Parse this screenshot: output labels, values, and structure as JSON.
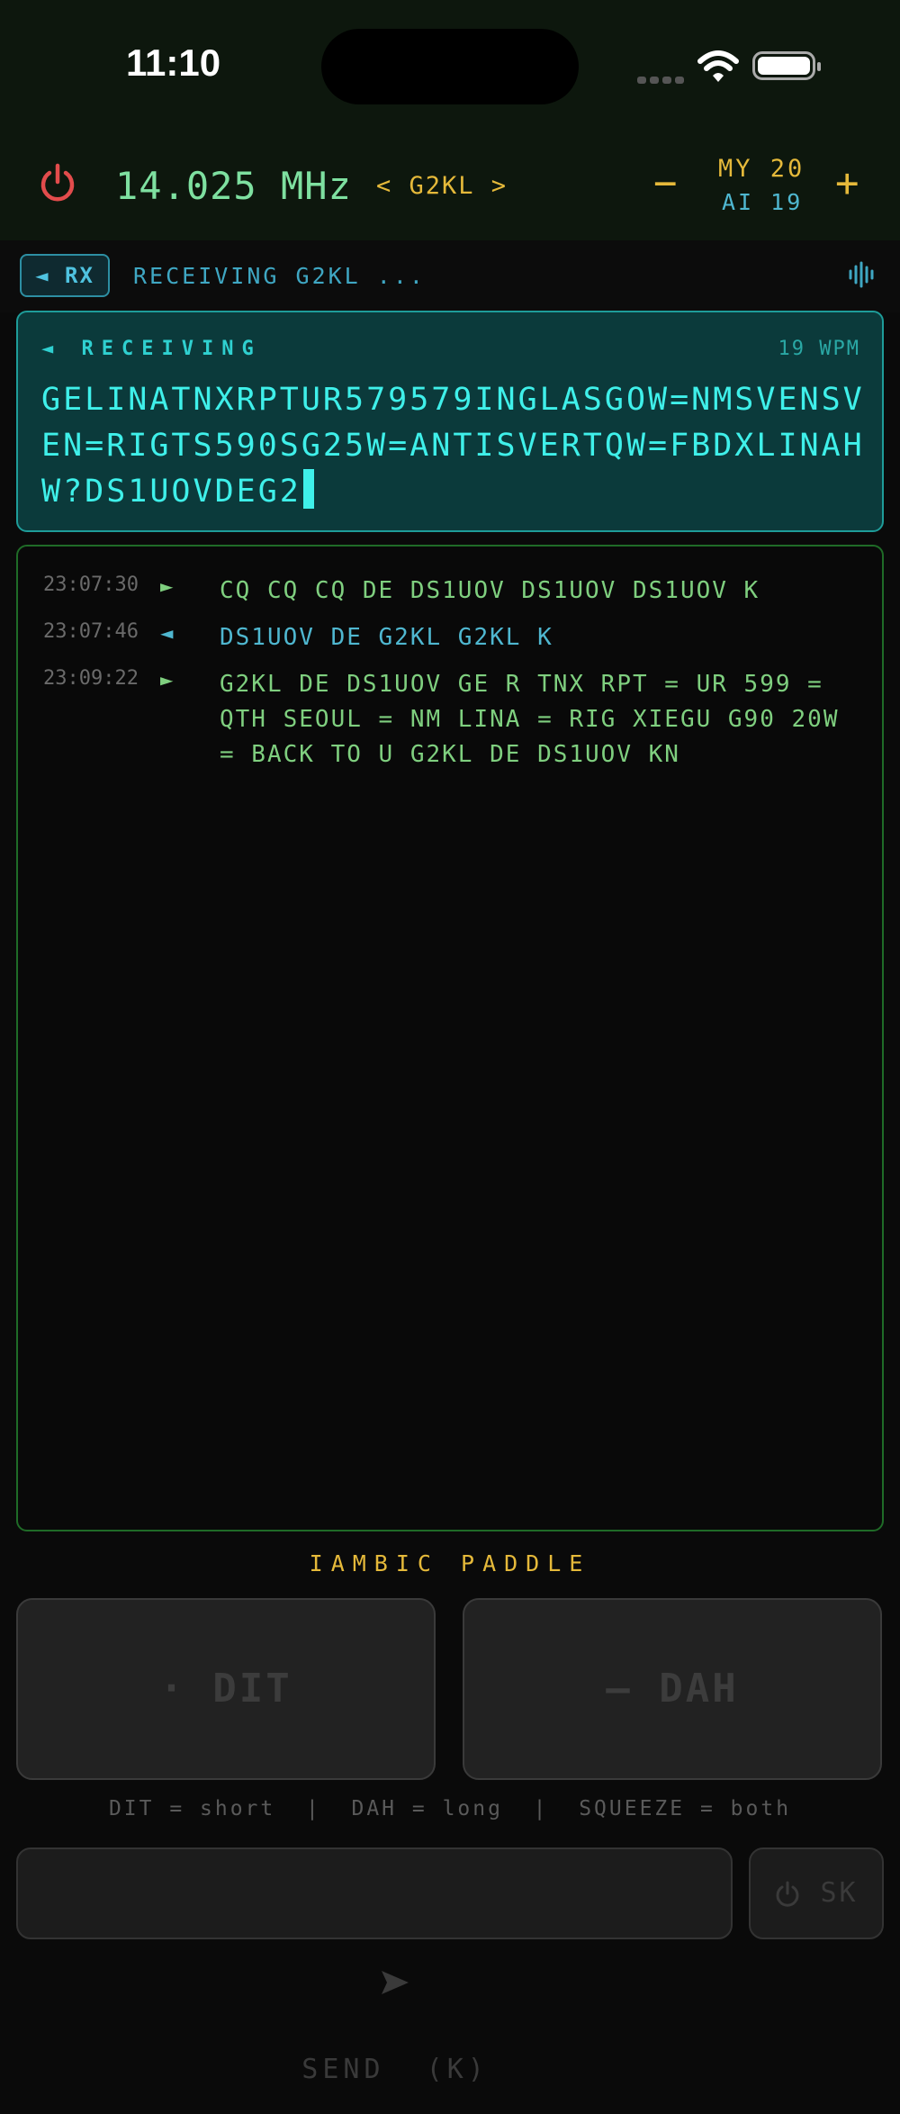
{
  "status_bar": {
    "time": "11:10"
  },
  "header": {
    "frequency": "14.025 MHz",
    "callsign_nav": "< G2KL >",
    "minus_label": "−",
    "plus_label": "+",
    "my_wpm": "MY 20",
    "ai_wpm": "AI 19"
  },
  "rx_bar": {
    "rx_button": "◄ RX",
    "status": "RECEIVING G2KL ..."
  },
  "receiving": {
    "label": "◄ RECEIVING",
    "wpm": "19 WPM",
    "text": "GELINATNXRPTUR579579INGLASGOW=NMSVENSVEN=RIGTS590SG25W=ANTISVERTQW=FBDXLINAHW?DS1UOVDEG2"
  },
  "log": [
    {
      "time": "23:07:30",
      "dir": "►",
      "kind": "sent",
      "text": "CQ CQ CQ DE DS1UOV DS1UOV DS1UOV K"
    },
    {
      "time": "23:07:46",
      "dir": "◄",
      "kind": "rcvd",
      "text": "DS1UOV DE G2KL G2KL K"
    },
    {
      "time": "23:09:22",
      "dir": "►",
      "kind": "sent",
      "text": "G2KL DE DS1UOV GE R TNX RPT = UR 599 = QTH SEOUL = NM LINA = RIG XIEGU G90 20W = BACK TO U G2KL DE DS1UOV KN"
    }
  ],
  "paddle": {
    "title": "IAMBIC PADDLE",
    "dit_label": "·  DIT",
    "dah_label": "—  DAH",
    "hint": "DIT = short  |  DAH = long  |  SQUEEZE = both"
  },
  "actions": {
    "send_label": "SEND  (K)",
    "sk_label": "SK"
  }
}
